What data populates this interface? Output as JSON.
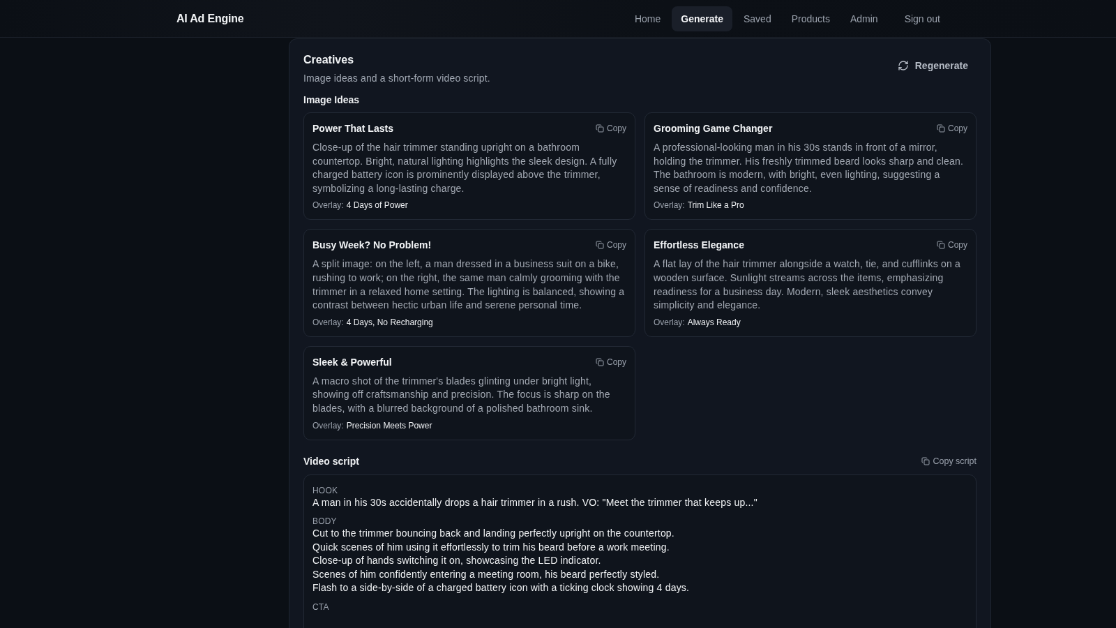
{
  "header": {
    "brand": "AI Ad Engine",
    "nav": [
      {
        "label": "Home",
        "selected": false
      },
      {
        "label": "Generate",
        "selected": true
      },
      {
        "label": "Saved",
        "selected": false
      },
      {
        "label": "Products",
        "selected": false
      },
      {
        "label": "Admin",
        "selected": false
      }
    ],
    "sign_out": "Sign out"
  },
  "creatives": {
    "title": "Creatives",
    "subtitle": "Image ideas and a short-form video script.",
    "regenerate": "Regenerate"
  },
  "image_ideas": {
    "heading": "Image Ideas",
    "cards": [
      {
        "title": "Power That Lasts",
        "copy": "Copy",
        "description": "Close-up of the hair trimmer standing upright on a bathroom countertop. Bright, natural lighting highlights the sleek design. A fully charged battery icon is prominently displayed above the trimmer, symbolizing a long-lasting charge.",
        "overlay_label": "Overlay:",
        "overlay": "4 Days of Power"
      },
      {
        "title": "Grooming Game Changer",
        "copy": "Copy",
        "description": "A professional-looking man in his 30s stands in front of a mirror, holding the trimmer. His freshly trimmed beard looks sharp and clean. The bathroom is modern, with bright, even lighting, suggesting a sense of readiness and confidence.",
        "overlay_label": "Overlay:",
        "overlay": "Trim Like a Pro"
      },
      {
        "title": "Busy Week? No Problem!",
        "copy": "Copy",
        "description": "A split image: on the left, a man dressed in a business suit on a bike, rushing to work; on the right, the same man calmly grooming with the trimmer in a relaxed home setting. The lighting is balanced, showing a contrast between hectic urban life and serene personal time.",
        "overlay_label": "Overlay:",
        "overlay": "4 Days, No Recharging"
      },
      {
        "title": "Effortless Elegance",
        "copy": "Copy",
        "description": "A flat lay of the hair trimmer alongside a watch, tie, and cufflinks on a wooden surface. Sunlight streams across the items, emphasizing readiness for a business day. Modern, sleek aesthetics convey simplicity and elegance.",
        "overlay_label": "Overlay:",
        "overlay": "Always Ready"
      },
      {
        "title": "Sleek & Powerful",
        "copy": "Copy",
        "description": "A macro shot of the trimmer's blades glinting under bright light, showing off craftsmanship and precision. The focus is sharp on the blades, with a blurred background of a polished bathroom sink.",
        "overlay_label": "Overlay:",
        "overlay": "Precision Meets Power"
      }
    ]
  },
  "video_script": {
    "heading": "Video script",
    "copy": "Copy script",
    "sections": [
      {
        "label": "HOOK",
        "lines": [
          "A man in his 30s accidentally drops a hair trimmer in a rush. VO: \"Meet the trimmer that keeps up...\""
        ]
      },
      {
        "label": "BODY",
        "lines": [
          "Cut to the trimmer bouncing back and landing perfectly upright on the countertop.",
          "Quick scenes of him using it effortlessly to trim his beard before a work meeting.",
          "Close-up of hands switching it on, showcasing the LED indicator.",
          "Scenes of him confidently entering a meeting room, his beard perfectly styled.",
          "Flash to a side-by-side of a charged battery icon with a ticking clock showing 4 days."
        ]
      },
      {
        "label": "CTA"
      }
    ]
  }
}
